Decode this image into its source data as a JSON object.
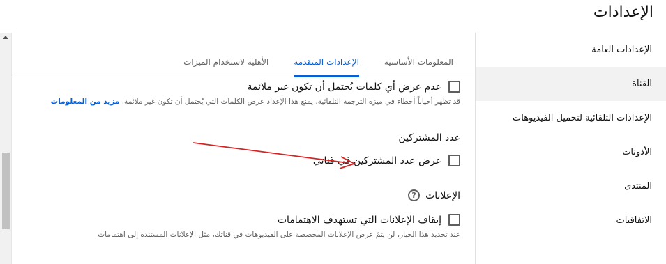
{
  "page": {
    "title": "الإعدادات"
  },
  "sidebar": {
    "items": [
      {
        "label": "الإعدادات العامة"
      },
      {
        "label": "القناة"
      },
      {
        "label": "الإعدادات التلقائية لتحميل الفيديوهات"
      },
      {
        "label": "الأذونات"
      },
      {
        "label": "المنتدى"
      },
      {
        "label": "الاتفاقيات"
      }
    ],
    "active_index": 1
  },
  "tabs": [
    {
      "label": "المعلومات الأساسية"
    },
    {
      "label": "الإعدادات المتقدمة"
    },
    {
      "label": "الأهلية لاستخدام الميزات"
    }
  ],
  "active_tab_index": 1,
  "content": {
    "inappropriate_words": {
      "label": "عدم عرض أي كلمات يُحتمل أن تكون غير ملائمة",
      "help": "قد تظهر أحياناً أخطاء في ميزة الترجمة التلقائية. يمنع هذا الإعداد عرض الكلمات التي يُحتمل أن تكون غير ملائمة.",
      "learn_more": "مزيد من المعلومات",
      "checked": false
    },
    "subscriber_count": {
      "section_title": "عدد المشتركين",
      "label": "عرض عدد المشتركين في قناتي",
      "checked": false
    },
    "ads": {
      "section_title": "الإعلانات",
      "label": "إيقاف الإعلانات التي تستهدف الاهتمامات",
      "help": "عند تحديد هذا الخيار، لن يتمّ عرض الإعلانات المخصصة على الفيديوهات في قناتك، مثل الإعلانات المستندة إلى اهتمامات",
      "checked": false
    }
  },
  "colors": {
    "accent": "#065fd4",
    "annotation_arrow": "#d62424"
  },
  "icons": {
    "help": "help-circle-icon",
    "scroll_up": "scroll-up-arrow-icon"
  }
}
